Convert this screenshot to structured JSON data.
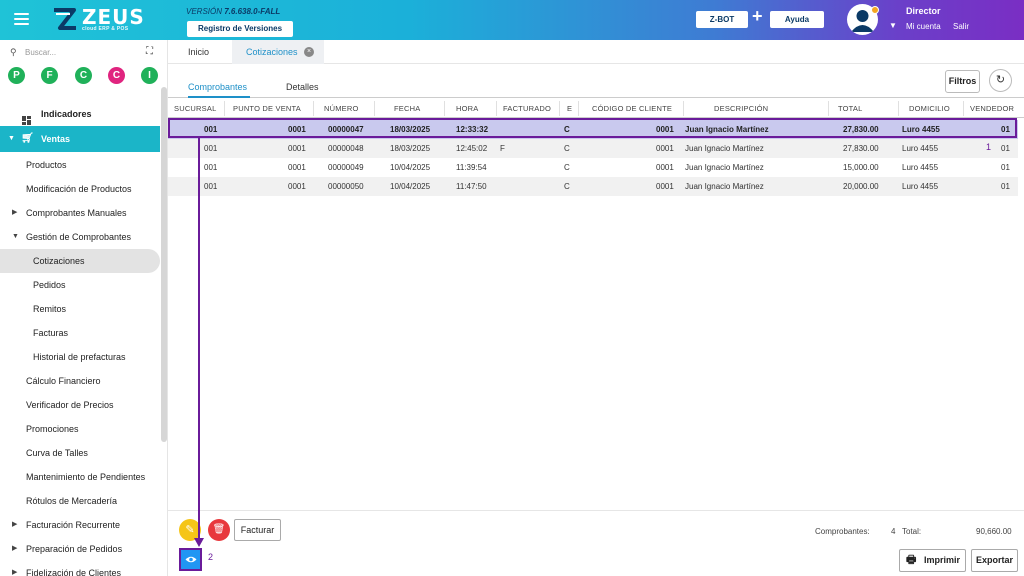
{
  "header": {
    "logo_text": "ZEUS",
    "logo_sub": "cloud ERP & POS",
    "version_prefix": "VERSIÓN ",
    "version_value": "7.6.638.0-FALL",
    "registro_label": "Registro de Versiones",
    "zbot_label": "Z-BOT",
    "plus": "+",
    "ayuda_label": "Ayuda",
    "user_name": "Director",
    "mi_cuenta": "Mi cuenta",
    "salir": "Salir"
  },
  "sidebar": {
    "search_placeholder": "Buscar...",
    "shortcuts": [
      {
        "letter": "P",
        "color": "#20b15a"
      },
      {
        "letter": "F",
        "color": "#20b15a"
      },
      {
        "letter": "C",
        "color": "#20b15a"
      },
      {
        "letter": "C",
        "color": "#e0247f"
      },
      {
        "letter": "I",
        "color": "#20b15a"
      }
    ],
    "items": [
      {
        "label": "Indicadores"
      },
      {
        "label": "Ventas"
      },
      {
        "label": "Productos"
      },
      {
        "label": "Modificación de Productos"
      },
      {
        "label": "Comprobantes Manuales"
      },
      {
        "label": "Gestión de Comprobantes"
      },
      {
        "label": "Cotizaciones"
      },
      {
        "label": "Pedidos"
      },
      {
        "label": "Remitos"
      },
      {
        "label": "Facturas"
      },
      {
        "label": "Historial de prefacturas"
      },
      {
        "label": "Cálculo Financiero"
      },
      {
        "label": "Verificador de Precios"
      },
      {
        "label": "Promociones"
      },
      {
        "label": "Curva de Talles"
      },
      {
        "label": "Mantenimiento de Pendientes"
      },
      {
        "label": "Rótulos de Mercadería"
      },
      {
        "label": "Facturación Recurrente"
      },
      {
        "label": "Preparación de Pedidos"
      },
      {
        "label": "Fidelización de Clientes"
      }
    ]
  },
  "tabs": {
    "inicio": "Inicio",
    "cotizaciones": "Cotizaciones",
    "close": "×"
  },
  "subtabs": {
    "comprobantes": "Comprobantes",
    "detalles": "Detalles"
  },
  "toolbar": {
    "filtros": "Filtros",
    "refresh_icon": "↻"
  },
  "table": {
    "columns": [
      "SUCURSAL",
      "PUNTO DE VENTA",
      "NÚMERO",
      "FECHA",
      "HORA",
      "FACTURADO",
      "E",
      "CÓDIGO DE CLIENTE",
      "DESCRIPCIÓN",
      "TOTAL",
      "DOMICILIO",
      "VENDEDOR"
    ],
    "rows": [
      {
        "sucursal": "001",
        "punto": "0001",
        "numero": "00000047",
        "fecha": "18/03/2025",
        "hora": "12:33:32",
        "facturado": "",
        "e": "C",
        "codigo": "0001",
        "descripcion": "Juan Ignacio Martínez",
        "total": "27,830.00",
        "domicilio": "Luro 4455",
        "vendedor": "01"
      },
      {
        "sucursal": "001",
        "punto": "0001",
        "numero": "00000048",
        "fecha": "18/03/2025",
        "hora": "12:45:02",
        "facturado": "F",
        "e": "C",
        "codigo": "0001",
        "descripcion": "Juan Ignacio Martínez",
        "total": "27,830.00",
        "domicilio": "Luro 4455",
        "vendedor": "01"
      },
      {
        "sucursal": "001",
        "punto": "0001",
        "numero": "00000049",
        "fecha": "10/04/2025",
        "hora": "11:39:54",
        "facturado": "",
        "e": "C",
        "codigo": "0001",
        "descripcion": "Juan Ignacio Martínez",
        "total": "15,000.00",
        "domicilio": "Luro 4455",
        "vendedor": "01"
      },
      {
        "sucursal": "001",
        "punto": "0001",
        "numero": "00000050",
        "fecha": "10/04/2025",
        "hora": "11:47:50",
        "facturado": "",
        "e": "C",
        "codigo": "0001",
        "descripcion": "Juan Ignacio Martínez",
        "total": "20,000.00",
        "domicilio": "Luro 4455",
        "vendedor": "01"
      }
    ]
  },
  "footer": {
    "facturar": "Facturar",
    "comprobantes_label": "Comprobantes:",
    "comprobantes_count": "4",
    "total_label": "Total:",
    "total_value": "90,660.00",
    "imprimir": "Imprimir",
    "exportar": "Exportar"
  },
  "annotations": {
    "step1": "1",
    "step2": "2"
  },
  "colors": {
    "accent": "#1bb5c8",
    "link": "#1e90c8",
    "annotation": "#6a1b9a"
  }
}
